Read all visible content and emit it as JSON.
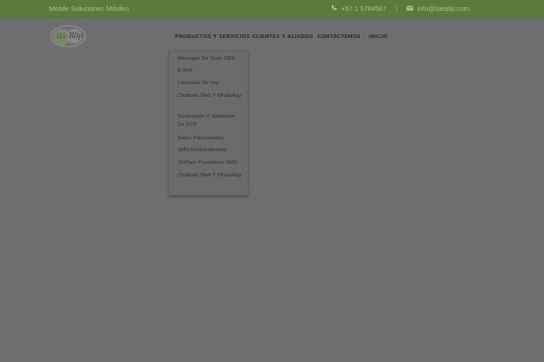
{
  "topbar": {
    "tagline": "Mobile Soluciones Móviles",
    "phone": "+57 1 5784567",
    "email": "info@bieblip.com",
    "phone_icon": "phone-icon",
    "email_icon": "envelope-icon",
    "bg_color": "#5a7a3e"
  },
  "logo": {
    "text": "BieBlip"
  },
  "nav": {
    "items": [
      "PRODUCTOS Y SERVICIOS",
      "CLIENTES Y ALIADOS",
      "CONTÁCTENOS",
      "INICIO"
    ]
  },
  "dropdown": {
    "items": [
      "Mensajes De Texto SMS",
      "E-Mail",
      "Llamadas De Voz",
      "Chatbots Web Y WhatsApp",
      "Generación Y Validación De OTP",
      "Datos Patrocinados",
      "SMS Geolocalizados",
      "OnPack Promotions SMS",
      "Chatbots Web Y WhatsApp"
    ]
  }
}
